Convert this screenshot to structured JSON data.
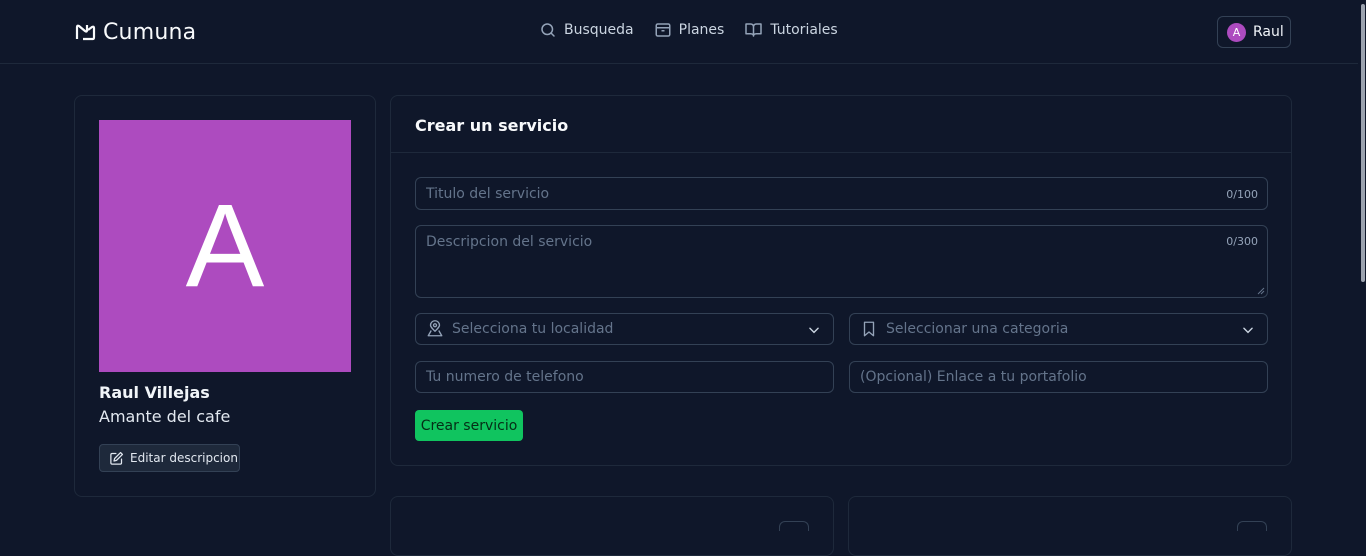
{
  "app": {
    "brand": "Cumuna"
  },
  "nav": {
    "items": [
      {
        "label": "Busqueda",
        "icon": "search-icon"
      },
      {
        "label": "Planes",
        "icon": "archive-icon"
      },
      {
        "label": "Tutoriales",
        "icon": "book-open-icon"
      }
    ]
  },
  "user": {
    "initial": "A",
    "name": "Raul"
  },
  "profile": {
    "avatar_initial": "A",
    "avatar_color": "#ad4bbf",
    "full_name": "Raul Villejas",
    "description": "Amante del cafe",
    "edit_label": "Editar descripcion"
  },
  "form": {
    "title": "Crear un servicio",
    "title_field": {
      "placeholder": "Titulo del servicio",
      "value": "",
      "counter": "0/100"
    },
    "description_field": {
      "placeholder": "Descripcion del servicio",
      "value": "",
      "counter": "0/300"
    },
    "location_select": {
      "placeholder": "Selecciona tu localidad",
      "icon": "map-pin-icon"
    },
    "category_select": {
      "placeholder": "Seleccionar una categoria",
      "icon": "bookmark-icon"
    },
    "phone_field": {
      "placeholder": "Tu numero de telefono",
      "value": ""
    },
    "portfolio_field": {
      "placeholder": "(Opcional) Enlace a tu portafolio",
      "value": ""
    },
    "submit_label": "Crear servicio",
    "accent_color": "#10c45f"
  }
}
